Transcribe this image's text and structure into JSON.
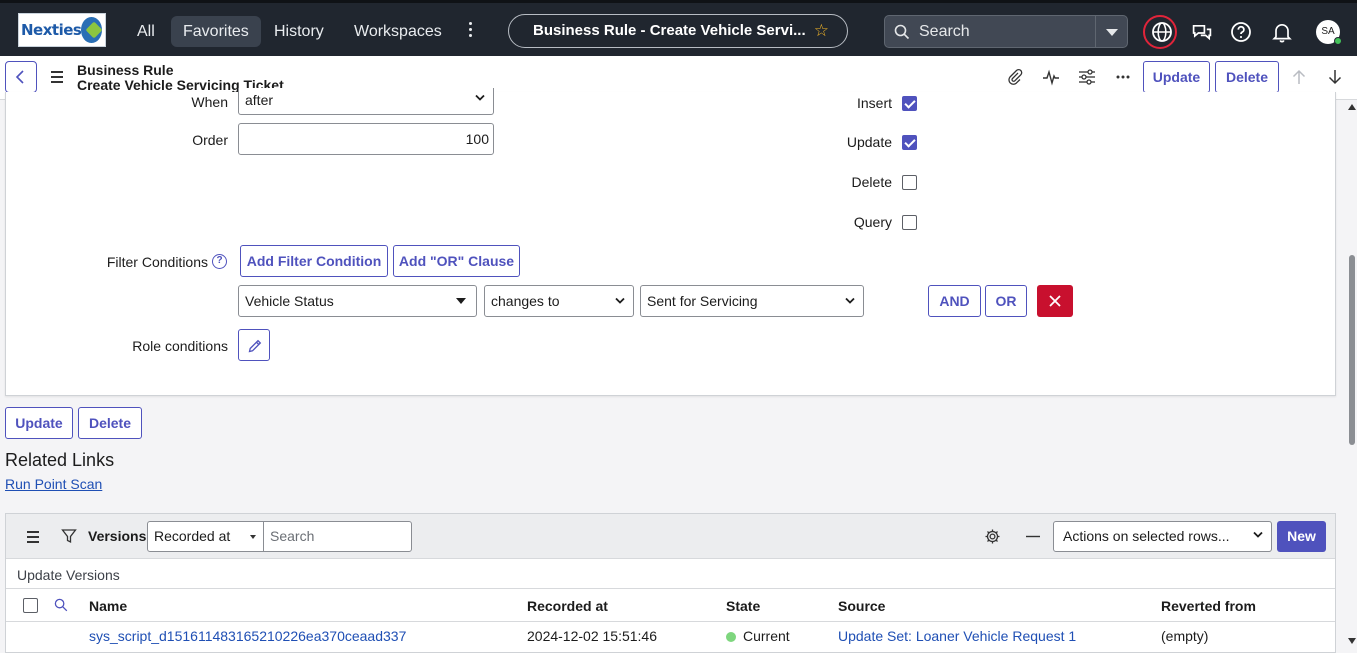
{
  "nav": {
    "logo_text": "Nexties",
    "all": "All",
    "favorites": "Favorites",
    "history": "History",
    "workspaces": "Workspaces",
    "title": "Business Rule - Create Vehicle Servi...",
    "search_placeholder": "Search",
    "avatar": "SA"
  },
  "header": {
    "record_type": "Business Rule",
    "record_name": "Create Vehicle Servicing Ticket",
    "update": "Update",
    "delete": "Delete"
  },
  "form": {
    "when_label": "When",
    "when_value": "after",
    "order_label": "Order",
    "order_value": "100",
    "insert_label": "Insert",
    "insert_checked": true,
    "update_label": "Update",
    "update_checked": true,
    "delete_label": "Delete",
    "delete_checked": false,
    "query_label": "Query",
    "query_checked": false,
    "filter_label": "Filter Conditions",
    "add_filter": "Add Filter Condition",
    "add_or": "Add \"OR\" Clause",
    "cond_field": "Vehicle Status",
    "cond_operator": "changes to",
    "cond_value": "Sent for Servicing",
    "and": "AND",
    "or": "OR",
    "role_label": "Role conditions"
  },
  "bottom_buttons": {
    "update": "Update",
    "delete": "Delete"
  },
  "related": {
    "title": "Related Links",
    "link": "Run Point Scan"
  },
  "versions": {
    "title": "Versions",
    "search_field": "Recorded at",
    "search_placeholder": "Search",
    "actions": "Actions on selected rows...",
    "new": "New",
    "subheading": "Update Versions",
    "columns": {
      "name": "Name",
      "recorded": "Recorded at",
      "state": "State",
      "source": "Source",
      "reverted": "Reverted from"
    },
    "rows": [
      {
        "name": "sys_script_d151611483165210226ea370ceaad337",
        "recorded": "2024-12-02 15:51:46",
        "state": "Current",
        "source": "Update Set: Loaner Vehicle Request 1",
        "reverted": "(empty)"
      }
    ]
  },
  "colors": {
    "accent": "#4f52bd",
    "nav_bg": "#20262f",
    "danger": "#c8102e",
    "link": "#1f4fb4",
    "state_current": "#7ed67e"
  }
}
